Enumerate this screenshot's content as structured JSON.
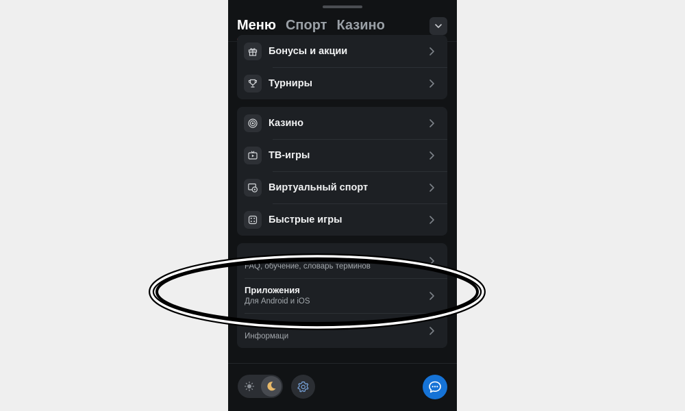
{
  "header": {
    "tabs": [
      {
        "label": "Меню",
        "active": true
      },
      {
        "label": "Спорт",
        "active": false
      },
      {
        "label": "Казино",
        "active": false
      }
    ],
    "collapse_icon": "chevron-down-icon"
  },
  "promo_group": [
    {
      "label": "Бонусы и акции",
      "icon": "gift-icon"
    },
    {
      "label": "Турниры",
      "icon": "trophy-icon"
    }
  ],
  "games_group": [
    {
      "label": "Казино",
      "icon": "casino-chip-icon"
    },
    {
      "label": "ТВ-игры",
      "icon": "tv-icon"
    },
    {
      "label": "Виртуальный спорт",
      "icon": "virtual-sport-icon"
    },
    {
      "label": "Быстрые игры",
      "icon": "dice-icon"
    }
  ],
  "info_group": [
    {
      "title": "",
      "subtitle": "FAQ, обучение, словарь терминов"
    },
    {
      "title": "Приложения",
      "subtitle": "Для Android и iOS"
    },
    {
      "title": "",
      "subtitle": "Информаци"
    }
  ],
  "footer": {
    "theme_options": [
      "sun-icon",
      "moon-icon"
    ],
    "active_theme": "moon-icon",
    "settings_icon": "gear-icon",
    "chat_icon": "chat-bubble-icon"
  },
  "colors": {
    "accent_underline": "#e0454b",
    "chat_button": "#1673d6",
    "background": "#111315",
    "card": "#1d2024"
  }
}
